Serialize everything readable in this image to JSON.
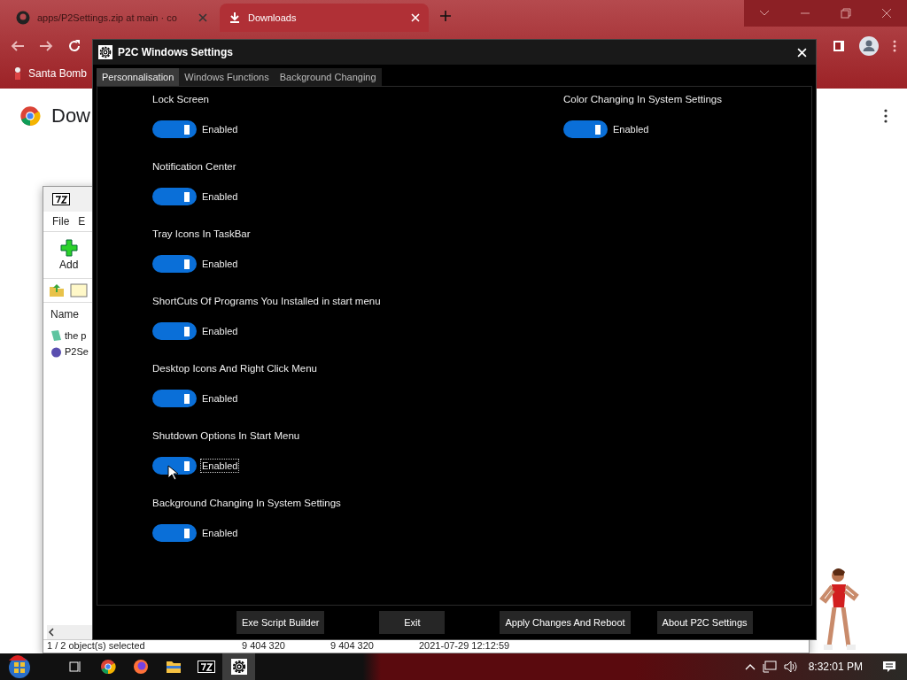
{
  "browser": {
    "tabs": [
      {
        "title": "apps/P2Settings.zip at main · co",
        "selected": false
      },
      {
        "title": "Downloads",
        "selected": true
      }
    ],
    "bookmarks": [
      "Santa Bomb"
    ],
    "page_heading": "Dow"
  },
  "archiver": {
    "menu": [
      "File",
      "E"
    ],
    "toolbar": [
      "Add"
    ],
    "column": "Name",
    "files": [
      {
        "name": "the p",
        "kind": "doc"
      },
      {
        "name": "P2Se",
        "kind": "exe"
      }
    ],
    "status": [
      "1 / 2 object(s) selected",
      "9 404 320",
      "9 404 320",
      "2021-07-29 12:12:59"
    ]
  },
  "dialog": {
    "title": "P2C Windows Settings",
    "tabs": [
      {
        "label": "Personnalisation",
        "selected": true
      },
      {
        "label": "Windows Functions",
        "selected": false
      },
      {
        "label": "Background Changing",
        "selected": false
      }
    ],
    "settings_left": [
      {
        "label": "Lock Screen",
        "on": true,
        "status": "Enabled",
        "focused": false
      },
      {
        "label": "Notification Center",
        "on": true,
        "status": "Enabled",
        "focused": false
      },
      {
        "label": "Tray Icons In TaskBar",
        "on": true,
        "status": "Enabled",
        "focused": false
      },
      {
        "label": "ShortCuts Of Programs You Installed in start menu",
        "on": true,
        "status": "Enabled",
        "focused": false
      },
      {
        "label": "Desktop Icons And Right Click Menu",
        "on": true,
        "status": "Enabled",
        "focused": false
      },
      {
        "label": "Shutdown Options In Start Menu",
        "on": true,
        "status": "Enabled",
        "focused": true
      },
      {
        "label": "Background Changing In System Settings",
        "on": true,
        "status": "Enabled",
        "focused": false
      }
    ],
    "settings_right": [
      {
        "label": "Color Changing In System Settings",
        "on": true,
        "status": "Enabled",
        "focused": false
      }
    ],
    "buttons": [
      "Exe Script Builder",
      "Exit",
      "Apply Changes And Reboot",
      "About P2C Settings"
    ]
  },
  "taskbar": {
    "apps": [
      {
        "kind": "taskview",
        "selected": false
      },
      {
        "kind": "chrome",
        "selected": false
      },
      {
        "kind": "firefox",
        "selected": false
      },
      {
        "kind": "folder",
        "selected": false
      },
      {
        "kind": "archiver",
        "selected": false
      },
      {
        "kind": "gear",
        "selected": true
      }
    ],
    "clock": "8:32:01 PM"
  }
}
